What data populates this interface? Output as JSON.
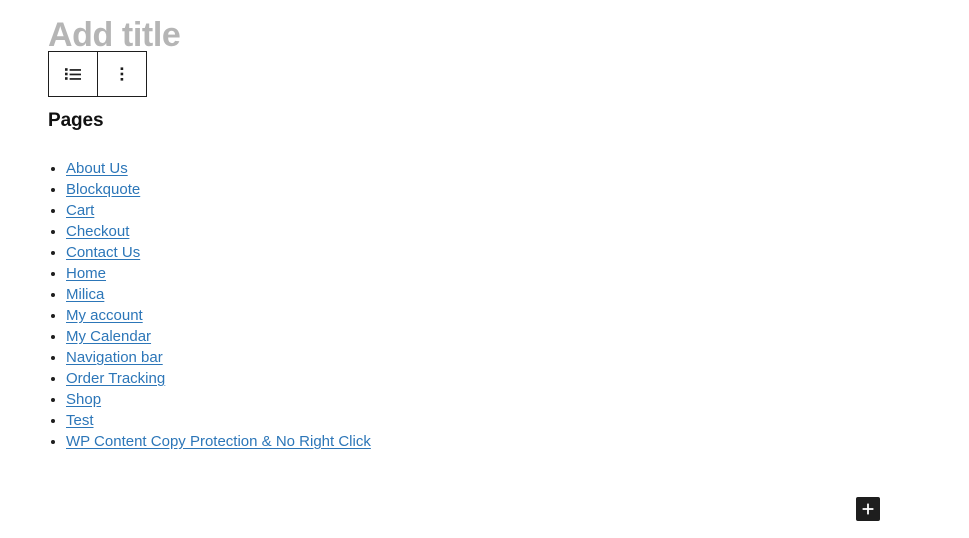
{
  "editor": {
    "title_placeholder": "Add title",
    "toolbar": {
      "list_block_label": "Page List",
      "list_icon": "list-view-icon",
      "options_label": "Options",
      "options_icon": "vertical-ellipsis-icon"
    },
    "inserter": {
      "label": "Add block",
      "icon": "plus-icon"
    }
  },
  "block": {
    "heading": "Pages",
    "pages": [
      {
        "label": "About Us"
      },
      {
        "label": "Blockquote"
      },
      {
        "label": "Cart"
      },
      {
        "label": "Checkout"
      },
      {
        "label": "Contact Us"
      },
      {
        "label": "Home"
      },
      {
        "label": "Milica"
      },
      {
        "label": "My account"
      },
      {
        "label": "My Calendar"
      },
      {
        "label": "Navigation bar"
      },
      {
        "label": "Order Tracking"
      },
      {
        "label": "Shop"
      },
      {
        "label": "Test"
      },
      {
        "label": "WP Content Copy Protection & No Right Click"
      }
    ]
  },
  "colors": {
    "link": "#2c76b8",
    "placeholder": "#b5b5b5",
    "toolbar_border": "#1e1e1e",
    "inserter_bg": "#1e1e1e",
    "text": "#1e1e1e"
  }
}
